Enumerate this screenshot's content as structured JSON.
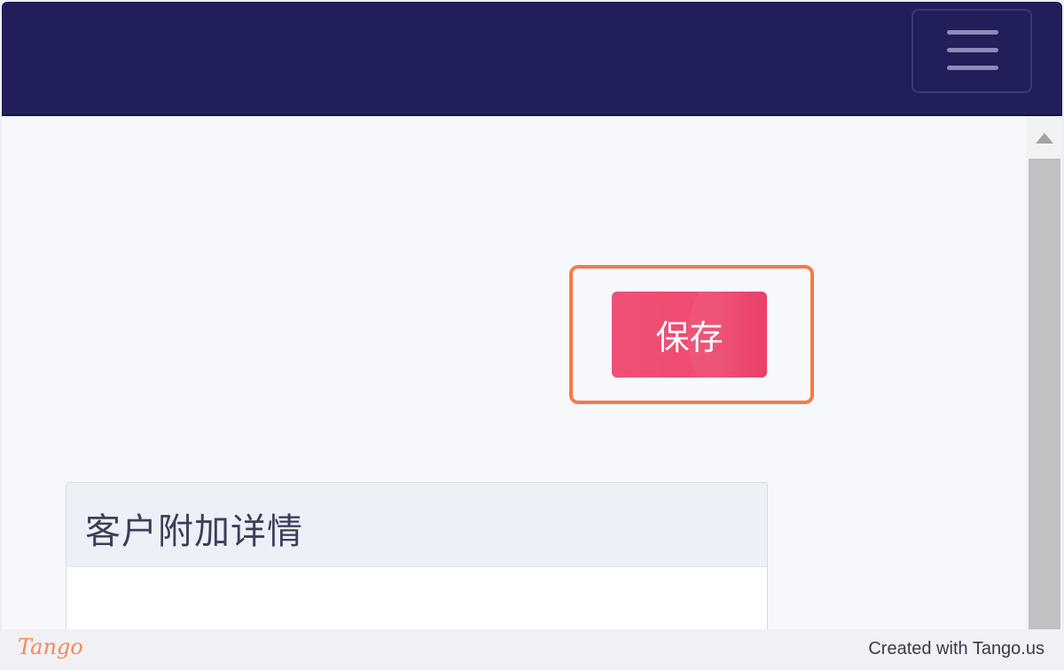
{
  "header": {
    "menu_icon": "hamburger-menu-icon",
    "background_color": "#211f59"
  },
  "main": {
    "save_button": {
      "label": "保存",
      "color": "#ef5075"
    },
    "highlight_color": "#f77a47",
    "card": {
      "title": "客户附加详情"
    }
  },
  "scrollbar": {
    "up_icon": "triangle-up-icon"
  },
  "footer": {
    "logo": "Tango",
    "credit": "Created with Tango.us"
  }
}
